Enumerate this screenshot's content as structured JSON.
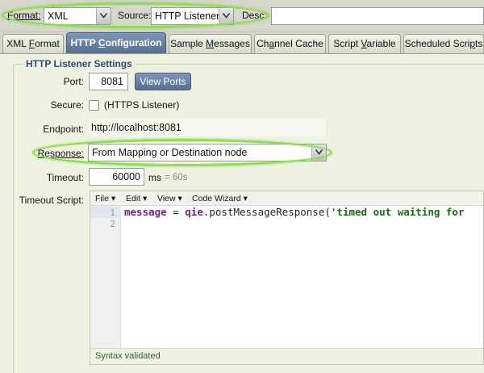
{
  "toolbar": {
    "format_label": "Format:",
    "format_value": "XML",
    "source_label": "Source:",
    "source_value": "HTTP Listener",
    "desc_label": "Desc:",
    "desc_value": ""
  },
  "tabs": [
    {
      "label": "XML Format",
      "active": false
    },
    {
      "label": "HTTP Configuration",
      "active": true
    },
    {
      "label": "Sample Messages",
      "active": false
    },
    {
      "label": "Channel Cache",
      "active": false
    },
    {
      "label": "Script Variable",
      "active": false
    },
    {
      "label": "Scheduled Scripts",
      "active": false
    }
  ],
  "settings": {
    "group_title": "HTTP Listener Settings",
    "port_label": "Port:",
    "port_value": "8081",
    "view_ports_label": "View Ports",
    "secure_label": "Secure:",
    "secure_checked": false,
    "secure_text": "(HTTPS Listener)",
    "endpoint_label": "Endpoint:",
    "endpoint_value": "http://localhost:8081",
    "response_label": "Response:",
    "response_value": "From Mapping or Destination node",
    "timeout_label": "Timeout:",
    "timeout_value": "60000",
    "timeout_unit": "ms",
    "timeout_hint": "= 60s",
    "timeout_script_label": "Timeout Script:"
  },
  "editor": {
    "menu": [
      "File",
      "Edit",
      "View",
      "Code Wizard"
    ],
    "line_numbers": [
      "1",
      "2"
    ],
    "code": {
      "var": "message",
      "op": " = ",
      "obj": "qie",
      "dot": ".",
      "method": "postMessageResponse",
      "paren": "(",
      "string": "'timed out waiting for"
    },
    "status": "Syntax validated"
  },
  "colors": {
    "active_tab": "#5e7699",
    "highlight": "#8be04d",
    "panel_bg": "#eff2e0"
  }
}
